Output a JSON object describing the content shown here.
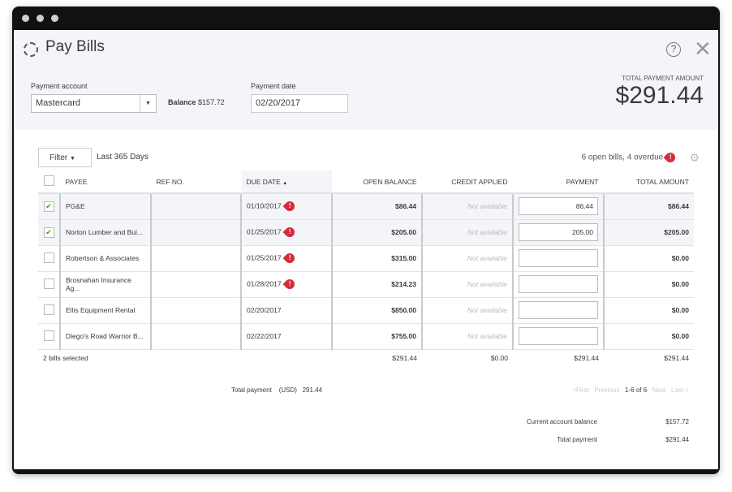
{
  "title": "Pay Bills",
  "payment_account": {
    "label": "Payment account",
    "value": "Mastercard",
    "balance_label": "Balance",
    "balance": "$157.72"
  },
  "payment_date": {
    "label": "Payment date",
    "value": "02/20/2017"
  },
  "total_payment_amount": {
    "label": "TOTAL PAYMENT AMOUNT",
    "value": "$291.44"
  },
  "filter": {
    "label": "Filter",
    "range": "Last 365 Days"
  },
  "summary": "6 open bills, 4 overdue",
  "columns": [
    "PAYEE",
    "REF NO.",
    "DUE DATE",
    "OPEN BALANCE",
    "CREDIT APPLIED",
    "PAYMENT",
    "TOTAL AMOUNT"
  ],
  "rows": [
    {
      "checked": true,
      "payee": "PG&E",
      "ref": "",
      "due": "01/10/2017",
      "overdue": true,
      "open": "$86.44",
      "credit": "Not available",
      "payment": "86.44",
      "total": "$86.44"
    },
    {
      "checked": true,
      "payee": "Norton Lumber and Bui...",
      "ref": "",
      "due": "01/25/2017",
      "overdue": true,
      "open": "$205.00",
      "credit": "Not available",
      "payment": "205.00",
      "total": "$205.00"
    },
    {
      "checked": false,
      "payee": "Robertson & Associates",
      "ref": "",
      "due": "01/25/2017",
      "overdue": true,
      "open": "$315.00",
      "credit": "Not available",
      "payment": "",
      "total": "$0.00"
    },
    {
      "checked": false,
      "payee": "Brosnahan Insurance Ag...",
      "ref": "",
      "due": "01/28/2017",
      "overdue": true,
      "open": "$214.23",
      "credit": "Not available",
      "payment": "",
      "total": "$0.00"
    },
    {
      "checked": false,
      "payee": "Ellis Equipment Rental",
      "ref": "",
      "due": "02/20/2017",
      "overdue": false,
      "open": "$850.00",
      "credit": "Not available",
      "payment": "",
      "total": "$0.00"
    },
    {
      "checked": false,
      "payee": "Diego's Road Warrior B...",
      "ref": "",
      "due": "02/22/2017",
      "overdue": false,
      "open": "$755.00",
      "credit": "Not available",
      "payment": "",
      "total": "$0.00"
    }
  ],
  "footer": {
    "selected": "2 bills selected",
    "open": "$291.44",
    "credit": "$0.00",
    "payment": "$291.44",
    "total": "$291.44"
  },
  "total_payment": {
    "label": "Total payment",
    "currency": "(USD)",
    "value": "291.44"
  },
  "pagination": {
    "first": "<First",
    "previous": "Previous",
    "range": "1-6 of 6",
    "next": "Next",
    "last": "Last >"
  },
  "balances": {
    "current_label": "Current account balance",
    "current": "$157.72",
    "total_label": "Total payment",
    "total": "$291.44"
  },
  "icons": {
    "overdue": "!",
    "sort": "▲",
    "caret": "▼",
    "check": "✔",
    "gear": "⚙",
    "help": "?",
    "close": "✕"
  }
}
